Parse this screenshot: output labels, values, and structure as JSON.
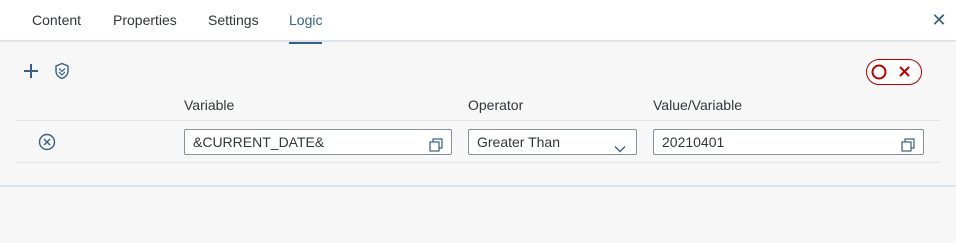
{
  "tabs": [
    {
      "label": "Content",
      "active": false
    },
    {
      "label": "Properties",
      "active": false
    },
    {
      "label": "Settings",
      "active": false
    },
    {
      "label": "Logic",
      "active": true
    }
  ],
  "toolbar": {
    "add_icon": "plus-icon",
    "condition_icon": "shield-check-icon",
    "toggle_icons": [
      "circle-icon",
      "close-icon"
    ]
  },
  "table": {
    "headers": {
      "variable": "Variable",
      "operator": "Operator",
      "value": "Value/Variable"
    },
    "rows": [
      {
        "variable": "&CURRENT_DATE&",
        "operator": "Greater Than",
        "value": "20210401"
      }
    ]
  },
  "colors": {
    "accent": "#346187",
    "danger": "#bb0000",
    "border": "#89919a"
  }
}
